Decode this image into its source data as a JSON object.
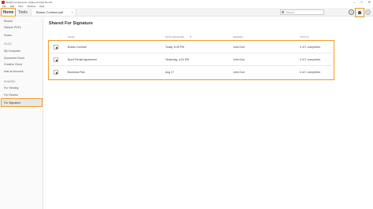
{
  "window": {
    "title": "Bodas Contract.pdf - Adobe Acrobat Pro DC",
    "controls": [
      "–",
      "□",
      "✕"
    ]
  },
  "menu": [
    "File",
    "Edit",
    "View",
    "Window",
    "Help"
  ],
  "toolbar": {
    "home_label": "Home",
    "tools_label": "Tools",
    "doc_tab_label": "Bodas Contract.pdf",
    "doc_tab_close": "×",
    "search_placeholder": "Search",
    "help_label": "?"
  },
  "sidebar": {
    "recent": "Recent",
    "sample_pdfs": "Sample PDFs",
    "scans": "Scans",
    "files_section": "FILES",
    "my_computer": "My Computer",
    "document_cloud": "Document Cloud",
    "creative_cloud": "Creative Cloud",
    "add_account": "Add an Account",
    "shared_section": "SHARED",
    "for_viewing": "For Viewing",
    "for_review": "For Review",
    "for_signature": "For Signature"
  },
  "main": {
    "title": "Shared For Signature",
    "columns": {
      "name": "NAME",
      "date": "DATE RECEIVED",
      "sender": "SENDER",
      "status": "STATUS"
    },
    "sort_arrow": "▼",
    "rows": [
      {
        "name": "Bodas Contract",
        "date": "Today, 8:45 PM",
        "sender": "John Doe",
        "status": "0 of 1 completed"
      },
      {
        "name": "Bond Rental Agreement",
        "date": "Yesterday, 4:24 PM",
        "sender": "John Doe",
        "status": "0 of 1 completed"
      },
      {
        "name": "Business Plan",
        "date": "Aug 27",
        "sender": "John Doe",
        "status": "0 of 1 completed"
      }
    ]
  },
  "accent_color": "#f29c1f"
}
